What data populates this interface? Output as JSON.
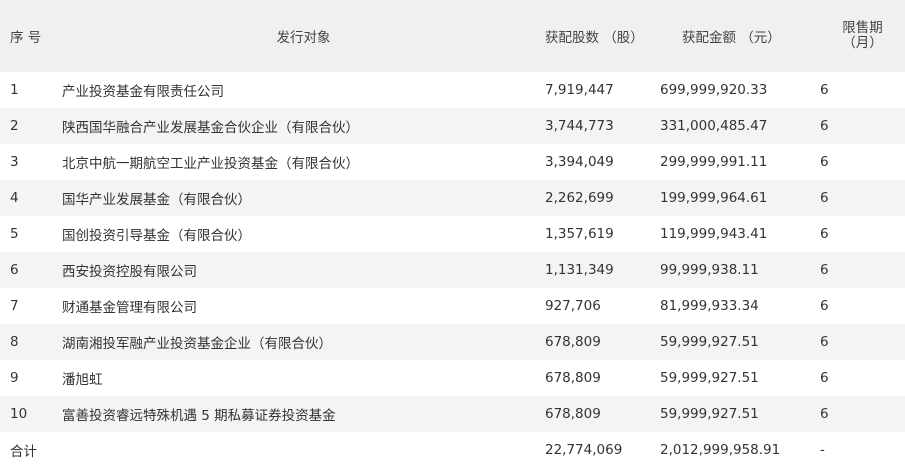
{
  "headers": {
    "no": "序 号",
    "investor": "发行对象",
    "shares": "获配股数 （股）",
    "amount": "获配金额 （元）",
    "lockup_line1": "限售期",
    "lockup_line2": "（月）"
  },
  "rows": [
    {
      "no": "1",
      "investor": "产业投资基金有限责任公司",
      "shares": "7,919,447",
      "amount": "699,999,920.33",
      "lockup": "6"
    },
    {
      "no": "2",
      "investor": "陕西国华融合产业发展基金合伙企业（有限合伙）",
      "shares": "3,744,773",
      "amount": "331,000,485.47",
      "lockup": "6"
    },
    {
      "no": "3",
      "investor": "北京中航一期航空工业产业投资基金（有限合伙）",
      "shares": "3,394,049",
      "amount": "299,999,991.11",
      "lockup": "6"
    },
    {
      "no": "4",
      "investor": "国华产业发展基金（有限合伙）",
      "shares": "2,262,699",
      "amount": "199,999,964.61",
      "lockup": "6"
    },
    {
      "no": "5",
      "investor": "国创投资引导基金（有限合伙）",
      "shares": "1,357,619",
      "amount": "119,999,943.41",
      "lockup": "6"
    },
    {
      "no": "6",
      "investor": "西安投资控股有限公司",
      "shares": "1,131,349",
      "amount": "99,999,938.11",
      "lockup": "6"
    },
    {
      "no": "7",
      "investor": "财通基金管理有限公司",
      "shares": "927,706",
      "amount": "81,999,933.34",
      "lockup": "6"
    },
    {
      "no": "8",
      "investor": "湖南湘投军融产业投资基金企业（有限合伙）",
      "shares": "678,809",
      "amount": "59,999,927.51",
      "lockup": "6"
    },
    {
      "no": "9",
      "investor": "潘旭虹",
      "shares": "678,809",
      "amount": "59,999,927.51",
      "lockup": "6"
    },
    {
      "no": "10",
      "investor": "富善投资睿远特殊机遇 5 期私募证券投资基金",
      "shares": "678,809",
      "amount": "59,999,927.51",
      "lockup": "6"
    }
  ],
  "total": {
    "label": "合计",
    "shares": "22,774,069",
    "amount": "2,012,999,958.91",
    "lockup": "-"
  }
}
